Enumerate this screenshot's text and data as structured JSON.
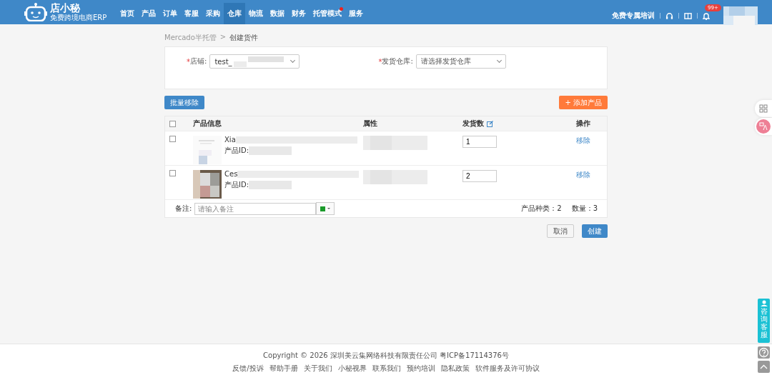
{
  "header": {
    "logo_text": "店小秘",
    "logo_sub": "免费跨境电商ERP",
    "nav": [
      {
        "label": "首页",
        "selected": false,
        "dot": false
      },
      {
        "label": "产品",
        "selected": false,
        "dot": false
      },
      {
        "label": "订单",
        "selected": false,
        "dot": false
      },
      {
        "label": "客服",
        "selected": false,
        "dot": false
      },
      {
        "label": "采购",
        "selected": false,
        "dot": false
      },
      {
        "label": "仓库",
        "selected": true,
        "dot": false
      },
      {
        "label": "物流",
        "selected": false,
        "dot": false
      },
      {
        "label": "数据",
        "selected": false,
        "dot": false
      },
      {
        "label": "财务",
        "selected": false,
        "dot": false
      },
      {
        "label": "托管模式",
        "selected": false,
        "dot": true
      },
      {
        "label": "服务",
        "selected": false,
        "dot": false
      }
    ],
    "training": "免费专属培训",
    "badge": "99+"
  },
  "breadcrumb": [
    "Mercado半托管",
    ">",
    "创建货件"
  ],
  "form": {
    "shop": {
      "required": "*",
      "label": "店铺:",
      "value": "test_"
    },
    "warehouse": {
      "required": "*",
      "label": "发货仓库:",
      "placeholder": "请选择发货仓库"
    }
  },
  "batch_remove": "批量移除",
  "add_product": "+ 添加产品",
  "table": {
    "select_all_checked": false,
    "columns": [
      "产品信息",
      "属性",
      "发货数",
      "操作"
    ],
    "rows": [
      {
        "checked": false,
        "name": "Xia",
        "id_label": "产品ID: ",
        "qty": "1",
        "action": "移除"
      },
      {
        "checked": false,
        "name": "Ces",
        "id_label": "产品ID:",
        "qty": "2",
        "action": "移除"
      }
    ],
    "note_label": "备注:",
    "note_placeholder": "请输入备注",
    "kinds": "产品种类：2",
    "quantity": "数量：3"
  },
  "cancel": "取消",
  "create": "创建",
  "side_help": "咨询客服",
  "footer": {
    "copyright": "Copyright © 2026 深圳美云集网络科技有限责任公司   粤ICP备17114376号",
    "links": [
      "反馈/投诉",
      "帮助手册",
      "关于我们",
      "小秘视界",
      "联系我们",
      "预约培训",
      "隐私政策",
      "软件服务及许可协议"
    ]
  }
}
